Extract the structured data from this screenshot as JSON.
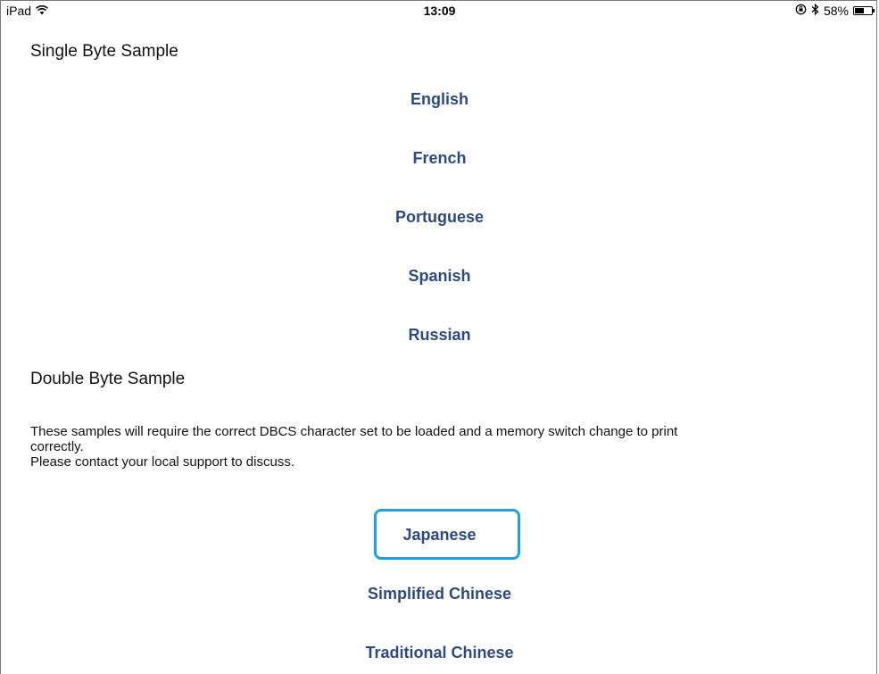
{
  "status_bar": {
    "device": "iPad",
    "time": "13:09",
    "battery_percent": "58%",
    "battery_level": 0.58,
    "icons": [
      "wifi-icon",
      "lock-rotation-icon",
      "bluetooth-icon",
      "battery-icon"
    ]
  },
  "single_byte": {
    "title": "Single Byte Sample",
    "languages": [
      "English",
      "French",
      "Portuguese",
      "Spanish",
      "Russian"
    ]
  },
  "double_byte": {
    "title": "Double Byte Sample",
    "note_lines": [
      "These samples will require the correct DBCS character set to be loaded and a memory switch change to print",
      "correctly.",
      "Please contact your local support to discuss."
    ],
    "languages": [
      "Japanese",
      "Simplified Chinese",
      "Traditional Chinese"
    ],
    "highlighted": "Japanese"
  },
  "colors": {
    "link": "#2f4a7a",
    "highlight_border": "#1ea3e0"
  }
}
